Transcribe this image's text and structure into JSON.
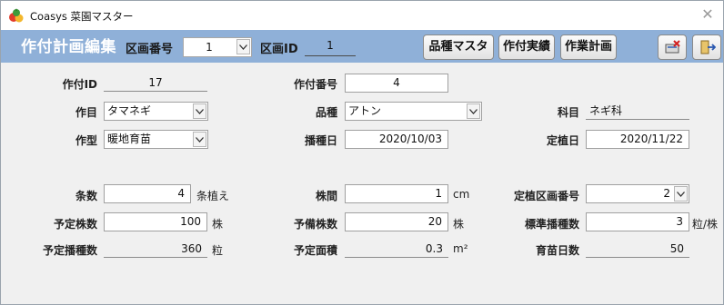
{
  "window": {
    "title": "Coasys 菜園マスター",
    "close_icon": "close-icon"
  },
  "header": {
    "form_title": "作付計画編集",
    "plot_number_label": "区画番号",
    "plot_number_value": "1",
    "plot_id_label": "区画ID",
    "plot_id_value": "1",
    "buttons": {
      "variety_master": "品種マスタ",
      "planting_record": "作付実績",
      "work_plan": "作業計画"
    },
    "icons": {
      "delete": "delete-record-icon",
      "exit": "exit-door-icon"
    },
    "colors": {
      "header_bg": "#8fb0d8",
      "title_fg": "#ffffff"
    }
  },
  "form": {
    "planting_id": {
      "label": "作付ID",
      "value": "17"
    },
    "planting_number": {
      "label": "作付番号",
      "value": "4"
    },
    "category": {
      "label": "作目",
      "value": "タマネギ"
    },
    "variety": {
      "label": "品種",
      "value": "アトン"
    },
    "family": {
      "label": "科目",
      "value": "ネギ科"
    },
    "type": {
      "label": "作型",
      "value": "暖地育苗"
    },
    "sowing_date": {
      "label": "播種日",
      "value": "2020/10/03"
    },
    "planting_date": {
      "label": "定植日",
      "value": "2020/11/22"
    },
    "rows": {
      "label": "条数",
      "value": "4",
      "unit": "条植え"
    },
    "spacing": {
      "label": "株間",
      "value": "1",
      "unit": "cm"
    },
    "plant_plot_number": {
      "label": "定植区画番号",
      "value": "2"
    },
    "planned_plants": {
      "label": "予定株数",
      "value": "100",
      "unit": "株"
    },
    "spare_plants": {
      "label": "予備株数",
      "value": "20",
      "unit": "株"
    },
    "seeds_per_plant": {
      "label": "標準播種数",
      "value": "3",
      "unit": "粒/株"
    },
    "planned_seeds": {
      "label": "予定播種数",
      "value": "360",
      "unit": "粒"
    },
    "planned_area": {
      "label": "予定面積",
      "value": "0.3",
      "unit": "m²"
    },
    "nursery_days": {
      "label": "育苗日数",
      "value": "50"
    }
  }
}
